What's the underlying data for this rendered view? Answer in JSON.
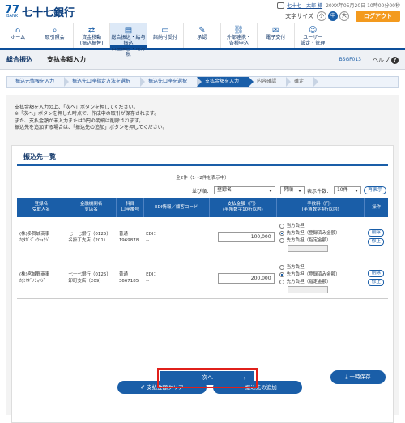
{
  "header": {
    "logo_mark": "77",
    "logo_sub": "BANK",
    "bank_name": "七十七銀行",
    "user_name": "七十七　太郎 様",
    "login_time": "20XX年05月20日 10時00分00秒",
    "font_size_label": "文字サイズ",
    "font_sizes": [
      "小",
      "中",
      "大"
    ],
    "active_font_size": "中",
    "logout_label": "ログアウト"
  },
  "global_nav": [
    {
      "label": "ホーム",
      "icon": "home-icon"
    },
    {
      "label": "取引照会",
      "icon": "search-icon"
    },
    {
      "label": "資金移動\n(振込振替)",
      "icon": "transfer-icon"
    },
    {
      "label": "総合振込・給与振込\n口座振替・地方税",
      "icon": "list-icon",
      "active": true
    },
    {
      "label": "諸納付受付",
      "icon": "document-icon"
    },
    {
      "label": "承認",
      "icon": "approve-icon"
    },
    {
      "label": "外部連携・\n各種申込",
      "icon": "link-icon"
    },
    {
      "label": "電子交付",
      "icon": "mail-icon"
    },
    {
      "label": "ユーザー\n設定・管理",
      "icon": "user-icon"
    }
  ],
  "titlebar": {
    "category": "総合振込",
    "title": "支払金額入力",
    "code": "BSGF013",
    "help": "ヘルプ"
  },
  "steps": [
    "振込元情報を入力",
    "振込先口座指定方法を選択",
    "振込先口座を選択",
    "支払金額を入力",
    "内容確認",
    "確定"
  ],
  "active_step_index": 3,
  "instructions": [
    "支払金額を入力の上、「次へ」ボタンを押してください。",
    "※「次へ」ボタンを押した時点で、作成中の取引が保存されます。",
    "また、支払金額が未入力または0円の明細は削除されます。",
    "振込先を追加する場合は、「振込先の追加」ボタンを押してください。"
  ],
  "list": {
    "heading": "振込先一覧",
    "count": "全2件（1～2件を表示中）",
    "sort_label": "並び順：",
    "sort_value": "登録名",
    "order_value": "昇順",
    "per_page_label": "表示件数：",
    "per_page_value": "10件",
    "resort_label": "再表示",
    "columns": [
      "登録名\n受取人名",
      "金融機関名\n支店名",
      "科目\n口座番号",
      "EDI情報／顧客コード",
      "支払金額（円）\n(半角数字10桁以内)",
      "手数料（円）\n(半角数字4桁以内)",
      "操作"
    ],
    "rows": [
      {
        "name1": "(株)多賀城商事",
        "name2": "ｶ)ﾀｶﾞｼﾞｮｳｼｮｳｼﾞ",
        "bank": "七十七銀行（0125）",
        "branch": "名掛丁支店（201）",
        "type": "普通",
        "account": "1969878",
        "edi": "EDI：",
        "customer": "--",
        "amount": "100,000",
        "fee_options": [
          "当方負担",
          "先方負担（登録済み金額）",
          "先方負担（指定金額）"
        ],
        "fee_selected": 1,
        "delete_label": "削除",
        "edit_label": "修正"
      },
      {
        "name1": "(株)宮城野商事",
        "name2": "ｶ)ﾐﾔｷﾞﾉｼｮｳｼﾞ",
        "bank": "七十七銀行（0125）",
        "branch": "卸町支店（209）",
        "type": "普通",
        "account": "3667185",
        "edi": "EDI：",
        "customer": "--",
        "amount": "200,000",
        "fee_options": [
          "当方負担",
          "先方負担（登録済み金額）",
          "先方負担（指定金額）"
        ],
        "fee_selected": 1,
        "delete_label": "削除",
        "edit_label": "修正"
      }
    ],
    "clear_label": "支払金額クリア",
    "add_label": "振込先の追加"
  },
  "footer": {
    "next_label": "次へ",
    "save_label": "一時保存"
  }
}
